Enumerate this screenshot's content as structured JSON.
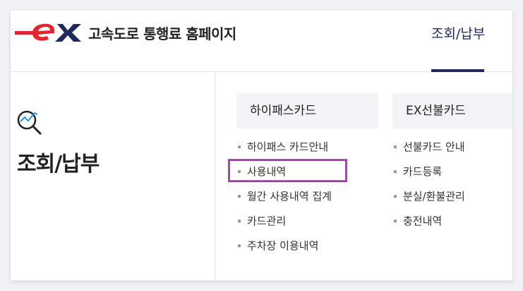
{
  "header": {
    "logo_text": "ex",
    "site_title": "고속도로 통행료 홈페이지",
    "nav_item": "조회/납부"
  },
  "sidebar": {
    "icon": "search-chart-icon",
    "title": "조회/납부"
  },
  "menus": [
    {
      "category": "하이패스카드",
      "items": [
        "하이패스 카드안내",
        "사용내역",
        "월간 사용내역 집계",
        "카드관리",
        "주차장 이용내역"
      ]
    },
    {
      "category": "EX선불카드",
      "items": [
        "선불카드 안내",
        "카드등록",
        "분실/환불관리",
        "충전내역"
      ]
    }
  ],
  "highlighted_item": "사용내역",
  "colors": {
    "brand_red": "#e0262f",
    "brand_navy": "#1f2a5a",
    "highlight": "#9b4aa5",
    "search_icon_accent": "#2a8fd6"
  }
}
